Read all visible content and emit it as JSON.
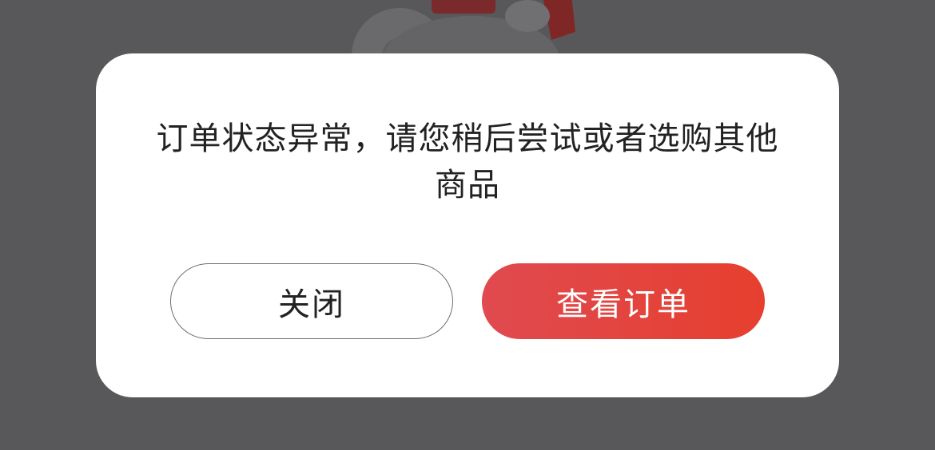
{
  "dialog": {
    "message": "订单状态异常，请您稍后尝试或者选购其他商品",
    "close_label": "关闭",
    "view_order_label": "查看订单"
  },
  "colors": {
    "overlay": "#58585a",
    "dialog_bg": "#ffffff",
    "primary_start": "#e04a50",
    "primary_end": "#e63f2e",
    "text": "#222222"
  },
  "icons": {
    "mascot": "mascot-illustration-icon"
  }
}
